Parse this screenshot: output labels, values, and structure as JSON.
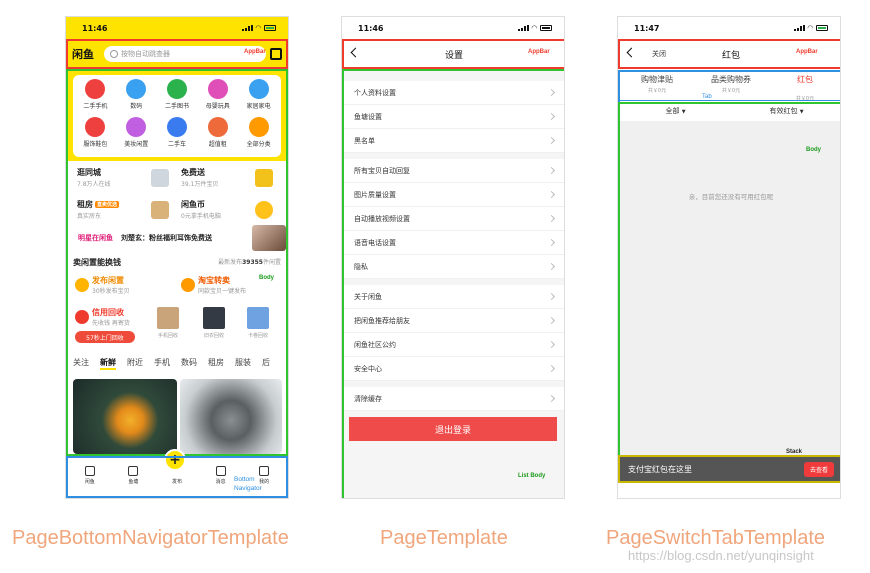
{
  "phone1": {
    "time": "11:46",
    "logo": "闲鱼",
    "search_placeholder": "按物自动跳查器",
    "appbar_tag": "AppBar",
    "categories": [
      "二手手机",
      "数码",
      "二手图书",
      "母婴玩具",
      "家居家电",
      "服饰鞋包",
      "美妆闲置",
      "二手车",
      "超值租",
      "全部分类"
    ],
    "category_colors": [
      "#ef4040",
      "#3aa0f0",
      "#2bb24c",
      "#e04fb8",
      "#3aa0f0",
      "#ef4040",
      "#c060e0",
      "#3a7cf0",
      "#ef6a3a",
      "#ff9a00"
    ],
    "promo": [
      {
        "title": "逛同城",
        "sub": "7.8万人在线"
      },
      {
        "title": "免费送",
        "sub": "39.1万件宝贝"
      },
      {
        "title": "租房",
        "badge": "直卖优选",
        "sub": "真实房东"
      },
      {
        "title": "闲鱼币",
        "sub": "0元拿手机电脑"
      }
    ],
    "banner_brand": "明星在闲鱼",
    "banner_text": "刘楚玄：粉丝福利耳饰免费送",
    "sell_title": "卖闲置能换钱",
    "sell_meta_prefix": "最新发布",
    "sell_meta_count": "39355",
    "sell_meta_suffix": "件闲置",
    "body_tag": "Body",
    "sell_items": [
      {
        "name": "发布闲置",
        "sub": "30秒发布宝贝"
      },
      {
        "name": "淘宝转卖",
        "sub": "同款宝贝一键发布"
      },
      {
        "name": "信用回收",
        "sub": "先收钱 再寄货"
      }
    ],
    "recycle_button": "57秒上门回收",
    "products": [
      "手机回收",
      "旧衣回收",
      "卡卷回收"
    ],
    "tabs": [
      "关注",
      "新鲜",
      "附近",
      "手机",
      "数码",
      "租房",
      "服装",
      "后"
    ],
    "active_tab": "新鲜",
    "nav": [
      "闲鱼",
      "鱼塘",
      "发布",
      "消息",
      "我的"
    ],
    "nav_tag_line1": "Bottom",
    "nav_tag_line2": "Navigator"
  },
  "phone2": {
    "time": "11:46",
    "title": "设置",
    "appbar_tag": "AppBar",
    "groups": [
      [
        "个人资料设置",
        "鱼塘设置",
        "黑名单"
      ],
      [
        "所有宝贝自动回复",
        "图片质量设置",
        "自动播放视频设置",
        "语音电话设置",
        "隐私"
      ],
      [
        "关于闲鱼",
        "把闲鱼推荐给朋友",
        "闲鱼社区公约",
        "安全中心"
      ],
      [
        "清除缓存"
      ]
    ],
    "logout": "退出登录",
    "list_body_tag": "List Body"
  },
  "phone3": {
    "time": "11:47",
    "close": "关闭",
    "title": "红包",
    "appbar_tag": "AppBar",
    "tabs": [
      {
        "label": "购物津贴",
        "sub": "共￥0元"
      },
      {
        "label": "品类购物券",
        "sub": "共￥0元"
      },
      {
        "label": "红包",
        "sub": "共￥0元"
      }
    ],
    "tab_tag": "Tab",
    "filters": [
      "全部",
      "有效红包"
    ],
    "body_tag": "Body",
    "empty_text": "亲，目前您还没有可用红包呢",
    "stack_tag": "Stack",
    "footer_text": "支付宝红包在这里",
    "footer_button": "去查看"
  },
  "captions": [
    "PageBottomNavigatorTemplate",
    "PageTemplate",
    "PageSwitchTabTemplate"
  ],
  "watermark": "https://blog.csdn.net/yunqinsight"
}
